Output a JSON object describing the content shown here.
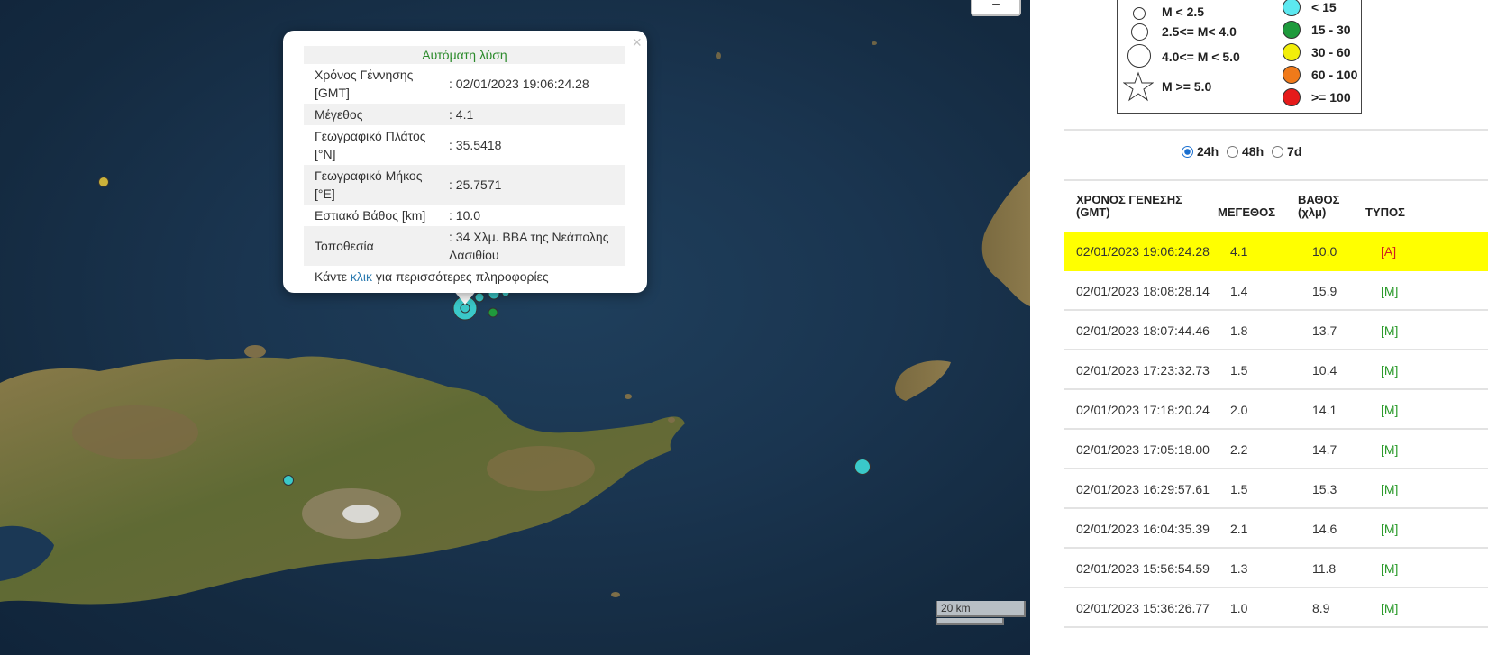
{
  "map": {
    "zoom_label": "–",
    "scale_label": "20 km"
  },
  "popup": {
    "close": "×",
    "title": "Αυτόματη λύση",
    "rows": [
      {
        "label": "Χρόνος Γέννησης [GMT]",
        "value": ": 02/01/2023 19:06:24.28"
      },
      {
        "label": "Μέγεθος",
        "value": ": 4.1"
      },
      {
        "label": "Γεωγραφικό Πλάτος [°N]",
        "value": ": 35.5418"
      },
      {
        "label": "Γεωγραφικό Μήκος [°E]",
        "value": ": 25.7571"
      },
      {
        "label": "Εστιακό Βάθος [km]",
        "value": ": 10.0"
      },
      {
        "label": "Τοποθεσία",
        "value": ": 34 Χλμ. ΒΒΑ της Νεάπολης Λασιθίου"
      }
    ],
    "more_prefix": "Κάντε ",
    "more_link": "κλικ",
    "more_suffix": " για περισσότερες πληροφορίες"
  },
  "legend": {
    "magnitudes": [
      "M < 2.5",
      "2.5<= M< 4.0",
      "4.0<= M < 5.0",
      "M >= 5.0"
    ],
    "depths": [
      {
        "label": "< 15",
        "color": "#5ce8f0"
      },
      {
        "label": "15 - 30",
        "color": "#1e9a3c"
      },
      {
        "label": "30 - 60",
        "color": "#f2ee0a"
      },
      {
        "label": "60 - 100",
        "color": "#f07a1a"
      },
      {
        "label": ">= 100",
        "color": "#e51b1b"
      }
    ]
  },
  "time_filter": {
    "options": [
      "24h",
      "48h",
      "7d"
    ],
    "selected": "24h"
  },
  "table": {
    "headers": {
      "time": "ΧΡΟΝΟΣ ΓΕΝΕΣΗΣ (GMT)",
      "magnitude": "ΜΕΓΕΘΟΣ",
      "depth": "ΒΑΘΟΣ (χλμ)",
      "type": "ΤΥΠΟΣ"
    },
    "rows": [
      {
        "time": "02/01/2023 19:06:24.28",
        "mag": "4.1",
        "depth": "10.0",
        "type": "[A]"
      },
      {
        "time": "02/01/2023 18:08:28.14",
        "mag": "1.4",
        "depth": "15.9",
        "type": "[M]"
      },
      {
        "time": "02/01/2023 18:07:44.46",
        "mag": "1.8",
        "depth": "13.7",
        "type": "[M]"
      },
      {
        "time": "02/01/2023 17:23:32.73",
        "mag": "1.5",
        "depth": "10.4",
        "type": "[M]"
      },
      {
        "time": "02/01/2023 17:18:20.24",
        "mag": "2.0",
        "depth": "14.1",
        "type": "[M]"
      },
      {
        "time": "02/01/2023 17:05:18.00",
        "mag": "2.2",
        "depth": "14.7",
        "type": "[M]"
      },
      {
        "time": "02/01/2023 16:29:57.61",
        "mag": "1.5",
        "depth": "15.3",
        "type": "[M]"
      },
      {
        "time": "02/01/2023 16:04:35.39",
        "mag": "2.1",
        "depth": "14.6",
        "type": "[M]"
      },
      {
        "time": "02/01/2023 15:56:54.59",
        "mag": "1.3",
        "depth": "11.8",
        "type": "[M]"
      },
      {
        "time": "02/01/2023 15:36:26.77",
        "mag": "1.0",
        "depth": "8.9",
        "type": "[M]"
      }
    ]
  }
}
